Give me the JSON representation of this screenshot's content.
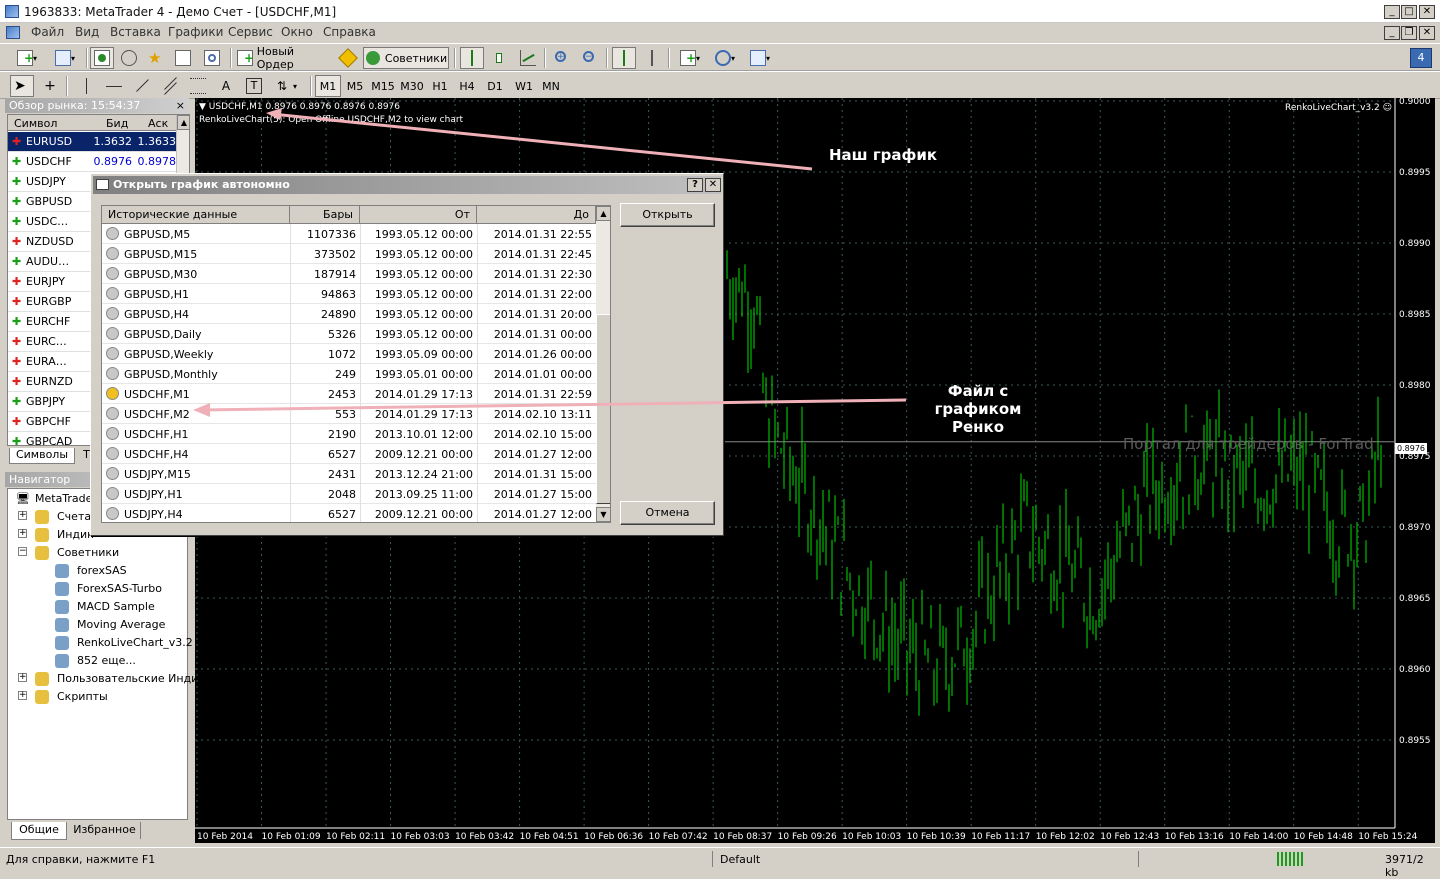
{
  "window": {
    "title": "1963833: MetaTrader 4 - Демо Счет - [USDCHF,M1]",
    "min": "_",
    "max": "□",
    "close": "✕",
    "min2": "_",
    "restore2": "❐",
    "close2": "✕"
  },
  "menu": [
    "Файл",
    "Вид",
    "Вставка",
    "Графики",
    "Сервис",
    "Окно",
    "Справка"
  ],
  "toolbar": {
    "new_order": "Новый Ордер",
    "experts": "Советники"
  },
  "timeframes": [
    "M1",
    "M5",
    "M15",
    "M30",
    "H1",
    "H4",
    "D1",
    "W1",
    "MN"
  ],
  "drawing_tools": {
    "text": "A",
    "label": "T"
  },
  "market_watch": {
    "title": "Обзор рынка: 15:54:37",
    "close": "×",
    "cols": [
      "Символ",
      "Бид",
      "Аск"
    ],
    "rows": [
      {
        "sym": "EURUSD",
        "bid": "1.3632",
        "ask": "1.3633",
        "dir": "down",
        "selected": true
      },
      {
        "sym": "USDCHF",
        "bid": "0.8976",
        "ask": "0.8978",
        "dir": "up"
      },
      {
        "sym": "USDJPY",
        "bid": "",
        "ask": "",
        "dir": "up"
      },
      {
        "sym": "GBPUSD",
        "bid": "",
        "ask": "",
        "dir": "up"
      },
      {
        "sym": "USDC…",
        "bid": "",
        "ask": "",
        "dir": "up"
      },
      {
        "sym": "NZDUSD",
        "bid": "",
        "ask": "",
        "dir": "down"
      },
      {
        "sym": "AUDU…",
        "bid": "",
        "ask": "",
        "dir": "up"
      },
      {
        "sym": "EURJPY",
        "bid": "",
        "ask": "",
        "dir": "down"
      },
      {
        "sym": "EURGBP",
        "bid": "",
        "ask": "",
        "dir": "down"
      },
      {
        "sym": "EURCHF",
        "bid": "",
        "ask": "",
        "dir": "up"
      },
      {
        "sym": "EURC…",
        "bid": "",
        "ask": "",
        "dir": "down"
      },
      {
        "sym": "EURA…",
        "bid": "",
        "ask": "",
        "dir": "down"
      },
      {
        "sym": "EURNZD",
        "bid": "",
        "ask": "",
        "dir": "down"
      },
      {
        "sym": "GBPJPY",
        "bid": "",
        "ask": "",
        "dir": "up"
      },
      {
        "sym": "GBPCHF",
        "bid": "",
        "ask": "",
        "dir": "down"
      },
      {
        "sym": "GBPCAD",
        "bid": "",
        "ask": "",
        "dir": "up"
      }
    ],
    "tabs": [
      "Символы",
      "Т"
    ]
  },
  "navigator": {
    "title": "Навигатор",
    "root": "MetaTrader",
    "items": [
      {
        "label": "Счета",
        "level": 1,
        "toggle": "+"
      },
      {
        "label": "Индик",
        "level": 1,
        "toggle": "+"
      },
      {
        "label": "Советники",
        "level": 1,
        "toggle": "−"
      },
      {
        "label": "forexSAS",
        "level": 2
      },
      {
        "label": "ForexSAS-Turbo",
        "level": 2
      },
      {
        "label": "MACD Sample",
        "level": 2
      },
      {
        "label": "Moving Average",
        "level": 2
      },
      {
        "label": "RenkoLiveChart_v3.2",
        "level": 2
      },
      {
        "label": "852 еще...",
        "level": 2
      },
      {
        "label": "Пользовательские Индик",
        "level": 1,
        "toggle": "+"
      },
      {
        "label": "Скрипты",
        "level": 1,
        "toggle": "+"
      }
    ],
    "tabs": [
      "Общие",
      "Избранное"
    ]
  },
  "chart": {
    "header": "▼ USDCHF,M1  0.8976 0.8976 0.8976 0.8976",
    "subtitle": "RenkoLiveChart(5): Open Offline USDCHF,M2 to view chart",
    "expert_label": "RenkoLiveChart_v3.2 ☺",
    "watermark": "Портал для трейдеров - ForTrad",
    "current_price": "0.8976",
    "price_ticks": [
      "0.9000",
      "0.8995",
      "0.8990",
      "0.8985",
      "0.8980",
      "0.8975",
      "0.8970",
      "0.8965",
      "0.8960",
      "0.8955"
    ],
    "time_ticks": [
      "10 Feb 2014",
      "10 Feb 01:09",
      "10 Feb 02:11",
      "10 Feb 03:03",
      "10 Feb 03:42",
      "10 Feb 04:51",
      "10 Feb 06:36",
      "10 Feb 07:42",
      "10 Feb 08:37",
      "10 Feb 09:26",
      "10 Feb 10:03",
      "10 Feb 10:39",
      "10 Feb 11:17",
      "10 Feb 12:02",
      "10 Feb 12:43",
      "10 Feb 13:16",
      "10 Feb 14:00",
      "10 Feb 14:48",
      "10 Feb 15:24"
    ],
    "annotation_1": "Наш график",
    "annotation_2": [
      "Файл с",
      "графиком",
      "Ренко"
    ],
    "colors": {
      "bg": "#000000",
      "bars": "#00e000",
      "grid": "#3a5a5a"
    }
  },
  "dialog": {
    "title": "Открыть график автономно",
    "help": "?",
    "close": "✕",
    "open_button": "Открыть",
    "cancel_button": "Отмена",
    "columns": [
      "Исторические данные",
      "Бары",
      "От",
      "До"
    ],
    "rows": [
      {
        "name": "GBPUSD,M5",
        "bars": "1107336",
        "from": "1993.05.12 00:00",
        "to": "2014.01.31 22:55"
      },
      {
        "name": "GBPUSD,M15",
        "bars": "373502",
        "from": "1993.05.12 00:00",
        "to": "2014.01.31 22:45"
      },
      {
        "name": "GBPUSD,M30",
        "bars": "187914",
        "from": "1993.05.12 00:00",
        "to": "2014.01.31 22:30"
      },
      {
        "name": "GBPUSD,H1",
        "bars": "94863",
        "from": "1993.05.12 00:00",
        "to": "2014.01.31 22:00"
      },
      {
        "name": "GBPUSD,H4",
        "bars": "24890",
        "from": "1993.05.12 00:00",
        "to": "2014.01.31 20:00"
      },
      {
        "name": "GBPUSD,Daily",
        "bars": "5326",
        "from": "1993.05.12 00:00",
        "to": "2014.01.31 00:00"
      },
      {
        "name": "GBPUSD,Weekly",
        "bars": "1072",
        "from": "1993.05.09 00:00",
        "to": "2014.01.26 00:00"
      },
      {
        "name": "GBPUSD,Monthly",
        "bars": "249",
        "from": "1993.05.01 00:00",
        "to": "2014.01.01 00:00"
      },
      {
        "name": "USDCHF,M1",
        "bars": "2453",
        "from": "2014.01.29 17:13",
        "to": "2014.01.31 22:59",
        "active": true
      },
      {
        "name": "USDCHF,M2",
        "bars": "553",
        "from": "2014.01.29 17:13",
        "to": "2014.02.10 13:11"
      },
      {
        "name": "USDCHF,H1",
        "bars": "2190",
        "from": "2013.10.01 12:00",
        "to": "2014.02.10 15:00"
      },
      {
        "name": "USDCHF,H4",
        "bars": "6527",
        "from": "2009.12.21 00:00",
        "to": "2014.01.27 12:00"
      },
      {
        "name": "USDJPY,M15",
        "bars": "2431",
        "from": "2013.12.24 21:00",
        "to": "2014.01.31 15:00"
      },
      {
        "name": "USDJPY,H1",
        "bars": "2048",
        "from": "2013.09.25 11:00",
        "to": "2014.01.27 15:00"
      },
      {
        "name": "USDJPY,H4",
        "bars": "6527",
        "from": "2009.12.21 00:00",
        "to": "2014.01.27 12:00"
      }
    ]
  },
  "status": {
    "help": "Для справки, нажмите F1",
    "profile": "Default",
    "traffic": "3971/2 kb"
  }
}
